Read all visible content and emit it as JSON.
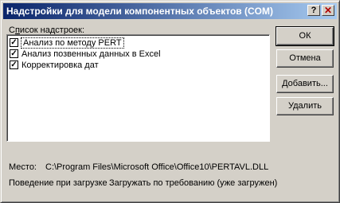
{
  "window": {
    "title": "Надстройки для модели компонентных объектов (COM)",
    "help_glyph": "?",
    "close_glyph": "✕"
  },
  "list": {
    "label_prefix": "С",
    "label_underlined": "п",
    "label_rest": "исок надстроек:",
    "items": [
      {
        "label": "Анализ по методу PERT",
        "checked": true,
        "check_glyph": "✓"
      },
      {
        "label": "Анализ позвенных данных в Excel",
        "checked": true,
        "check_glyph": "✓"
      },
      {
        "label": "Корректировка дат",
        "checked": true,
        "check_glyph": "✓"
      }
    ]
  },
  "buttons": {
    "ok": "ОК",
    "cancel": "Отмена",
    "add": "Добавить...",
    "remove": "Удалить"
  },
  "info": {
    "location_label": "Место:",
    "location_value": "C:\\Program Files\\Microsoft Office\\Office10\\PERTAVL.DLL",
    "load_behavior_label": "Поведение при загрузке",
    "load_behavior_value": "Загружать по требованию (уже загружен)"
  }
}
